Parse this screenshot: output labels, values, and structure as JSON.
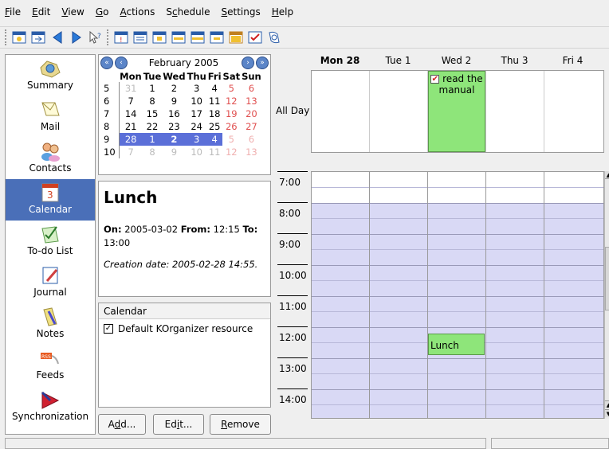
{
  "menubar": {
    "items": [
      {
        "pre": "",
        "ul": "F",
        "post": "ile"
      },
      {
        "pre": "",
        "ul": "E",
        "post": "dit"
      },
      {
        "pre": "",
        "ul": "V",
        "post": "iew"
      },
      {
        "pre": "",
        "ul": "G",
        "post": "o"
      },
      {
        "pre": "",
        "ul": "A",
        "post": "ctions"
      },
      {
        "pre": "S",
        "ul": "c",
        "post": "hedule"
      },
      {
        "pre": "",
        "ul": "S",
        "post": "ettings"
      },
      {
        "pre": "",
        "ul": "H",
        "post": "elp"
      }
    ]
  },
  "sidebar": {
    "items": [
      {
        "label": "Summary",
        "icon": "summary-icon"
      },
      {
        "label": "Mail",
        "icon": "mail-icon"
      },
      {
        "label": "Contacts",
        "icon": "contacts-icon"
      },
      {
        "label": "Calendar",
        "icon": "calendar-icon"
      },
      {
        "label": "To-do List",
        "icon": "todo-icon"
      },
      {
        "label": "Journal",
        "icon": "journal-icon"
      },
      {
        "label": "Notes",
        "icon": "notes-icon"
      },
      {
        "label": "Feeds",
        "icon": "rss-icon"
      },
      {
        "label": "Synchronization",
        "icon": "sync-icon"
      }
    ]
  },
  "minical": {
    "month": "February 2005",
    "weekdays": [
      "Mon",
      "Tue",
      "Wed",
      "Thu",
      "Fri",
      "Sat",
      "Sun"
    ],
    "weeks": [
      {
        "wk": "5",
        "days": [
          "31",
          "1",
          "2",
          "3",
          "4",
          "5",
          "6"
        ]
      },
      {
        "wk": "6",
        "days": [
          "7",
          "8",
          "9",
          "10",
          "11",
          "12",
          "13"
        ]
      },
      {
        "wk": "7",
        "days": [
          "14",
          "15",
          "16",
          "17",
          "18",
          "19",
          "20"
        ]
      },
      {
        "wk": "8",
        "days": [
          "21",
          "22",
          "23",
          "24",
          "25",
          "26",
          "27"
        ]
      },
      {
        "wk": "9",
        "days": [
          "28",
          "1",
          "2",
          "3",
          "4",
          "5",
          "6"
        ]
      },
      {
        "wk": "10",
        "days": [
          "7",
          "8",
          "9",
          "10",
          "11",
          "12",
          "13"
        ]
      }
    ]
  },
  "details": {
    "title": "Lunch",
    "on_label": "On:",
    "on_value": "2005-03-02",
    "from_label": "From:",
    "from_value": "12:15",
    "to_label": "To:",
    "to_value": "13:00",
    "creation": "Creation date: 2005-02-28 14:55."
  },
  "resources": {
    "header": "Calendar",
    "items": [
      {
        "label": "Default KOrganizer resource",
        "checked": true
      }
    ]
  },
  "buttons": {
    "add": {
      "pre": "A",
      "ul": "d",
      "post": "d..."
    },
    "edit": {
      "pre": "Ed",
      "ul": "i",
      "post": "t..."
    },
    "remove": {
      "pre": "",
      "ul": "R",
      "post": "emove"
    }
  },
  "agenda": {
    "days": [
      "Mon 28",
      "Tue 1",
      "Wed 2",
      "Thu 3",
      "Fri 4"
    ],
    "allday_label": "All Day",
    "allday_event": {
      "title": "read the manual",
      "checked": true
    },
    "hours": [
      "7:00",
      "8:00",
      "9:00",
      "10:00",
      "11:00",
      "12:00",
      "13:00",
      "14:00"
    ],
    "event": {
      "title": "Lunch"
    }
  },
  "colors": {
    "selection": "#4a6fb8",
    "event_green": "#8ee57a",
    "grid_lavender": "#d9d9f5"
  }
}
